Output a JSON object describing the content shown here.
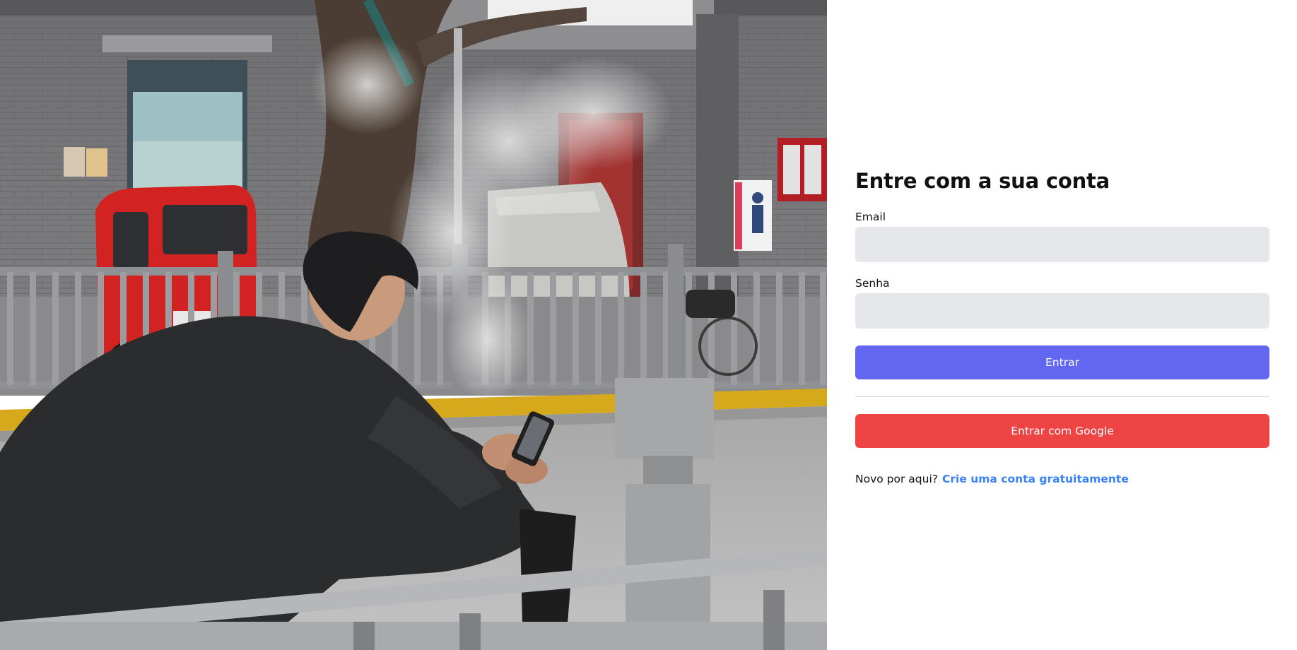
{
  "login_page": {
    "title": "Entre com a sua conta",
    "email": {
      "label": "Email",
      "value": "",
      "placeholder": ""
    },
    "password": {
      "label": "Senha",
      "value": "",
      "placeholder": ""
    },
    "login_button_label": "Entrar",
    "google_button_label": "Entrar com Google",
    "signup_prompt": "Novo por aqui?",
    "signup_link_label": "Crie uma conta gratuitamente"
  },
  "colors": {
    "primary_button": "#6366f1",
    "google_button": "#ef4444",
    "link": "#3b82f6",
    "input_background": "#e5e7eb"
  }
}
